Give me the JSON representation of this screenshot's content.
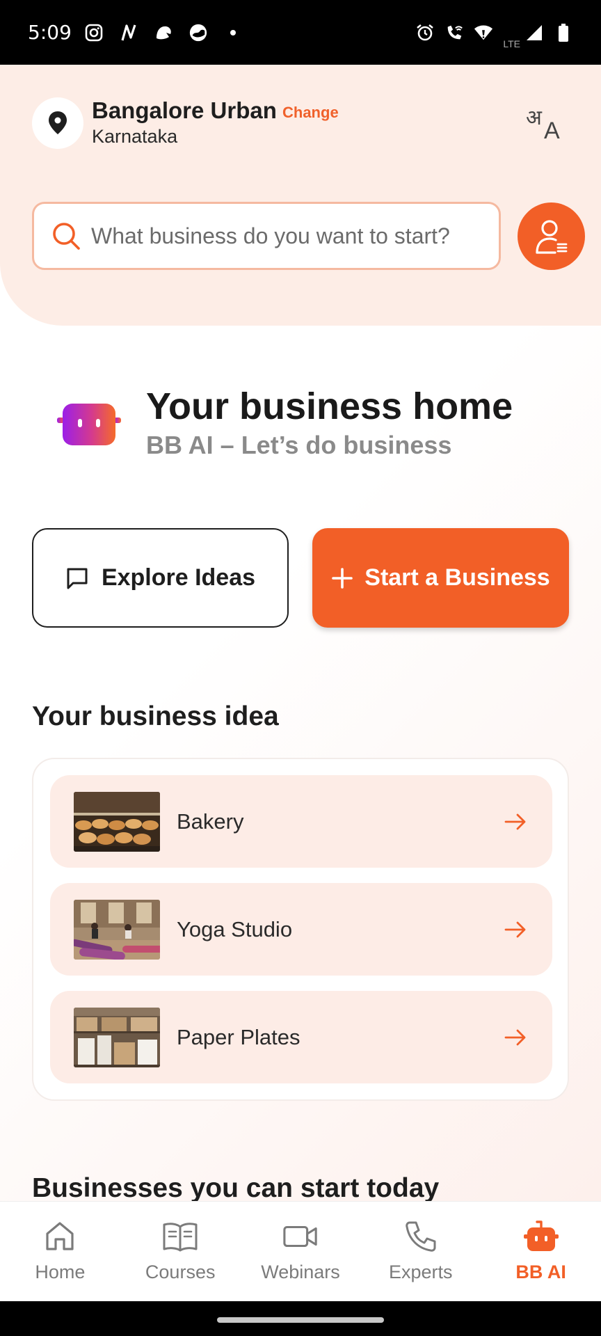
{
  "status_bar": {
    "time": "5:09",
    "network_label": "LTE",
    "left_icons": [
      "instagram-icon",
      "n-app-icon",
      "notification-app-icon",
      "chat-app-icon",
      "dot-icon"
    ],
    "right_icons": [
      "alarm-icon",
      "wifi-calling-icon",
      "wifi-icon",
      "signal-icon",
      "battery-icon"
    ]
  },
  "location": {
    "city": "Bangalore Urban",
    "change_label": "Change",
    "state": "Karnataka"
  },
  "language_toggle": {
    "label": "अA"
  },
  "search": {
    "placeholder": "What business do you want to start?"
  },
  "hero": {
    "title": "Your business home",
    "subtitle": "BB AI – Let’s do business"
  },
  "actions": {
    "explore_label": "Explore Ideas",
    "start_label": "Start a Business"
  },
  "ideas_section": {
    "title": "Your business idea",
    "items": [
      {
        "label": "Bakery",
        "thumb": "bakery-photo"
      },
      {
        "label": "Yoga Studio",
        "thumb": "yoga-studio-photo"
      },
      {
        "label": "Paper Plates",
        "thumb": "paper-plates-photo"
      }
    ]
  },
  "today_section": {
    "title": "Businesses you can start today"
  },
  "bottom_nav": {
    "items": [
      {
        "label": "Home",
        "icon": "home-icon",
        "active": false
      },
      {
        "label": "Courses",
        "icon": "book-icon",
        "active": false
      },
      {
        "label": "Webinars",
        "icon": "video-icon",
        "active": false
      },
      {
        "label": "Experts",
        "icon": "phone-icon",
        "active": false
      },
      {
        "label": "BB AI",
        "icon": "robot-icon",
        "active": true
      }
    ]
  },
  "colors": {
    "accent": "#f25f27",
    "header_bg": "#fdede6",
    "idea_row_bg": "#fdece6"
  }
}
